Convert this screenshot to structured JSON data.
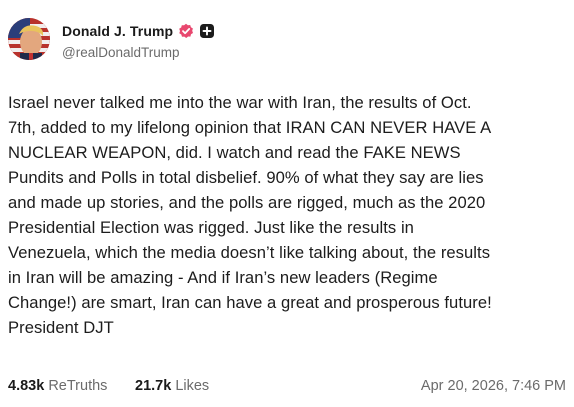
{
  "author": {
    "display_name": "Donald J. Trump",
    "handle": "@realDonaldTrump"
  },
  "icons": {
    "verified": "verified-badge-icon",
    "more": "plus-square-icon",
    "verified_color": "#e8486f"
  },
  "post": {
    "text": "Israel never talked me into the war with Iran, the results of Oct.\n7th, added to my lifelong opinion that IRAN CAN NEVER HAVE A\nNUCLEAR WEAPON, did. I watch and read the FAKE NEWS\nPundits and Polls in total disbelief. 90% of what they say are lies\nand made up stories, and the polls are rigged, much as the 2020\nPresidential Election was rigged. Just like the results in\nVenezuela, which the media doesn’t like talking about, the results\nin Iran will be amazing - And if Iran’s new leaders (Regime\nChange!) are smart, Iran can have a great and prosperous future!\nPresident DJT"
  },
  "stats": {
    "retruths_count": "4.83k",
    "retruths_label": "ReTruths",
    "likes_count": "21.7k",
    "likes_label": "Likes"
  },
  "timestamp": "Apr 20, 2026, 7:46 PM"
}
